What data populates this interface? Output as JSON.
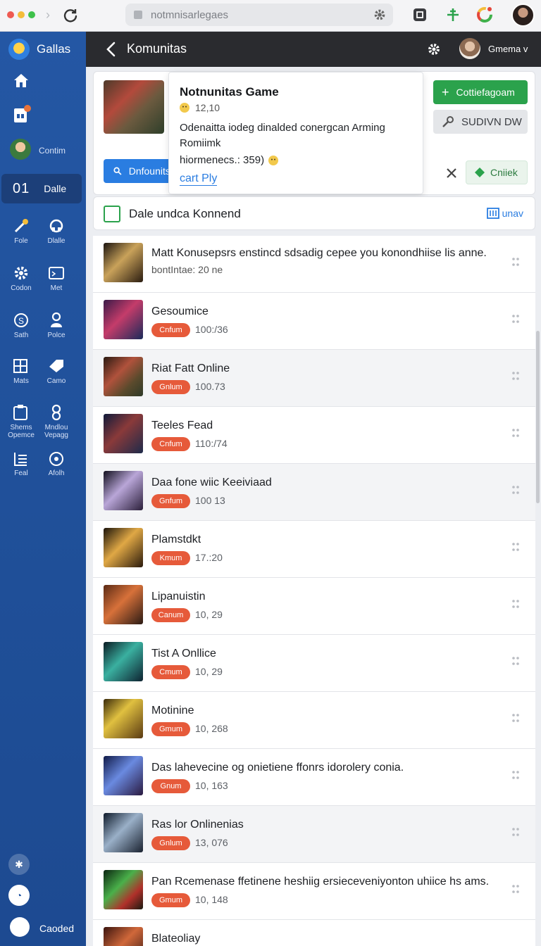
{
  "browser": {
    "url": "notmnisarlegaes",
    "colors": {
      "close": "#ee5a52",
      "minimize": "#f4bd3a",
      "maximize": "#3fc14b"
    }
  },
  "sidebar": {
    "brand": "Gallas",
    "active": {
      "number": "01",
      "label": "Dalle"
    },
    "items": [
      {
        "label": "Contim",
        "icon": "avatar-icon"
      },
      {
        "label": "Fole",
        "icon": "magic-wand-icon"
      },
      {
        "label": "Dlalle",
        "icon": "headset-icon"
      },
      {
        "label": "Codon",
        "icon": "gear-icon"
      },
      {
        "label": "Met",
        "icon": "monitor-icon"
      },
      {
        "label": "Sath",
        "icon": "coin-icon"
      },
      {
        "label": "Polce",
        "icon": "person-icon"
      },
      {
        "label": "Mats",
        "icon": "grid-icon"
      },
      {
        "label": "Camo",
        "icon": "tag-icon"
      },
      {
        "label": "Shems Opemce",
        "icon": "clipboard-icon"
      },
      {
        "label": "Mndlou Vepagg",
        "icon": "infinity-icon"
      },
      {
        "label": "Feal",
        "icon": "list-icon"
      },
      {
        "label": "Afolh",
        "icon": "target-icon"
      }
    ],
    "footer_label": "Caoded"
  },
  "header": {
    "title": "Komunitas",
    "username": "Gmema v"
  },
  "game": {
    "title": "Notnunitas Game",
    "score": "12,10",
    "description": "Odenaitta iodeg dinalded conergcan Arming Romiimk",
    "stats": "hiormenecs.: 359)",
    "link": "cart Ply",
    "search_label": "Dnfounitsi",
    "primary_action": "Cottiefagoam",
    "secondary_action": "SUDIVN DW",
    "chip_action": "Cniiek"
  },
  "section": {
    "title": "Dale undca Konnend",
    "right_label": "unav"
  },
  "list": [
    {
      "title": "Matt Konusepsrs enstincd sdsadig cepee you konondhiise lis anne.",
      "subtitle": "bontIntae: 20 ne",
      "tag": "",
      "count": ""
    },
    {
      "title": "Gesoumice",
      "tag": "Cnfum",
      "count": "100:/36"
    },
    {
      "title": "Riat Fatt Online",
      "tag": "Gnlum",
      "count": "100.73"
    },
    {
      "title": "Teeles Fead",
      "tag": "Cnfum",
      "count": "110:/74"
    },
    {
      "title": "Daa fone wiic Keeiviaad",
      "tag": "Gnfum",
      "count": "100 13"
    },
    {
      "title": "Plamstdkt",
      "tag": "Kmum",
      "count": "17.:20"
    },
    {
      "title": "Lipanuistin",
      "tag": "Canum",
      "count": "10, 29"
    },
    {
      "title": "Tist A Onllice",
      "tag": "Cmum",
      "count": "10, 29"
    },
    {
      "title": "Motinine",
      "tag": "Gmum",
      "count": "10, 268"
    },
    {
      "title": "Das lahevecine og onietiene ffonrs idorolery conia.",
      "tag": "Gnum",
      "count": "10, 163"
    },
    {
      "title": "Ras lor Onlinenias",
      "tag": "Gnlum",
      "count": "13, 076"
    },
    {
      "title": "Pan Rcemenase ffetinene heshiig ersieceveniyonton uhiice hs ams.",
      "tag": "Gmum",
      "count": "10, 148"
    },
    {
      "title": "Blateoliay",
      "tag": "",
      "count": ""
    }
  ]
}
